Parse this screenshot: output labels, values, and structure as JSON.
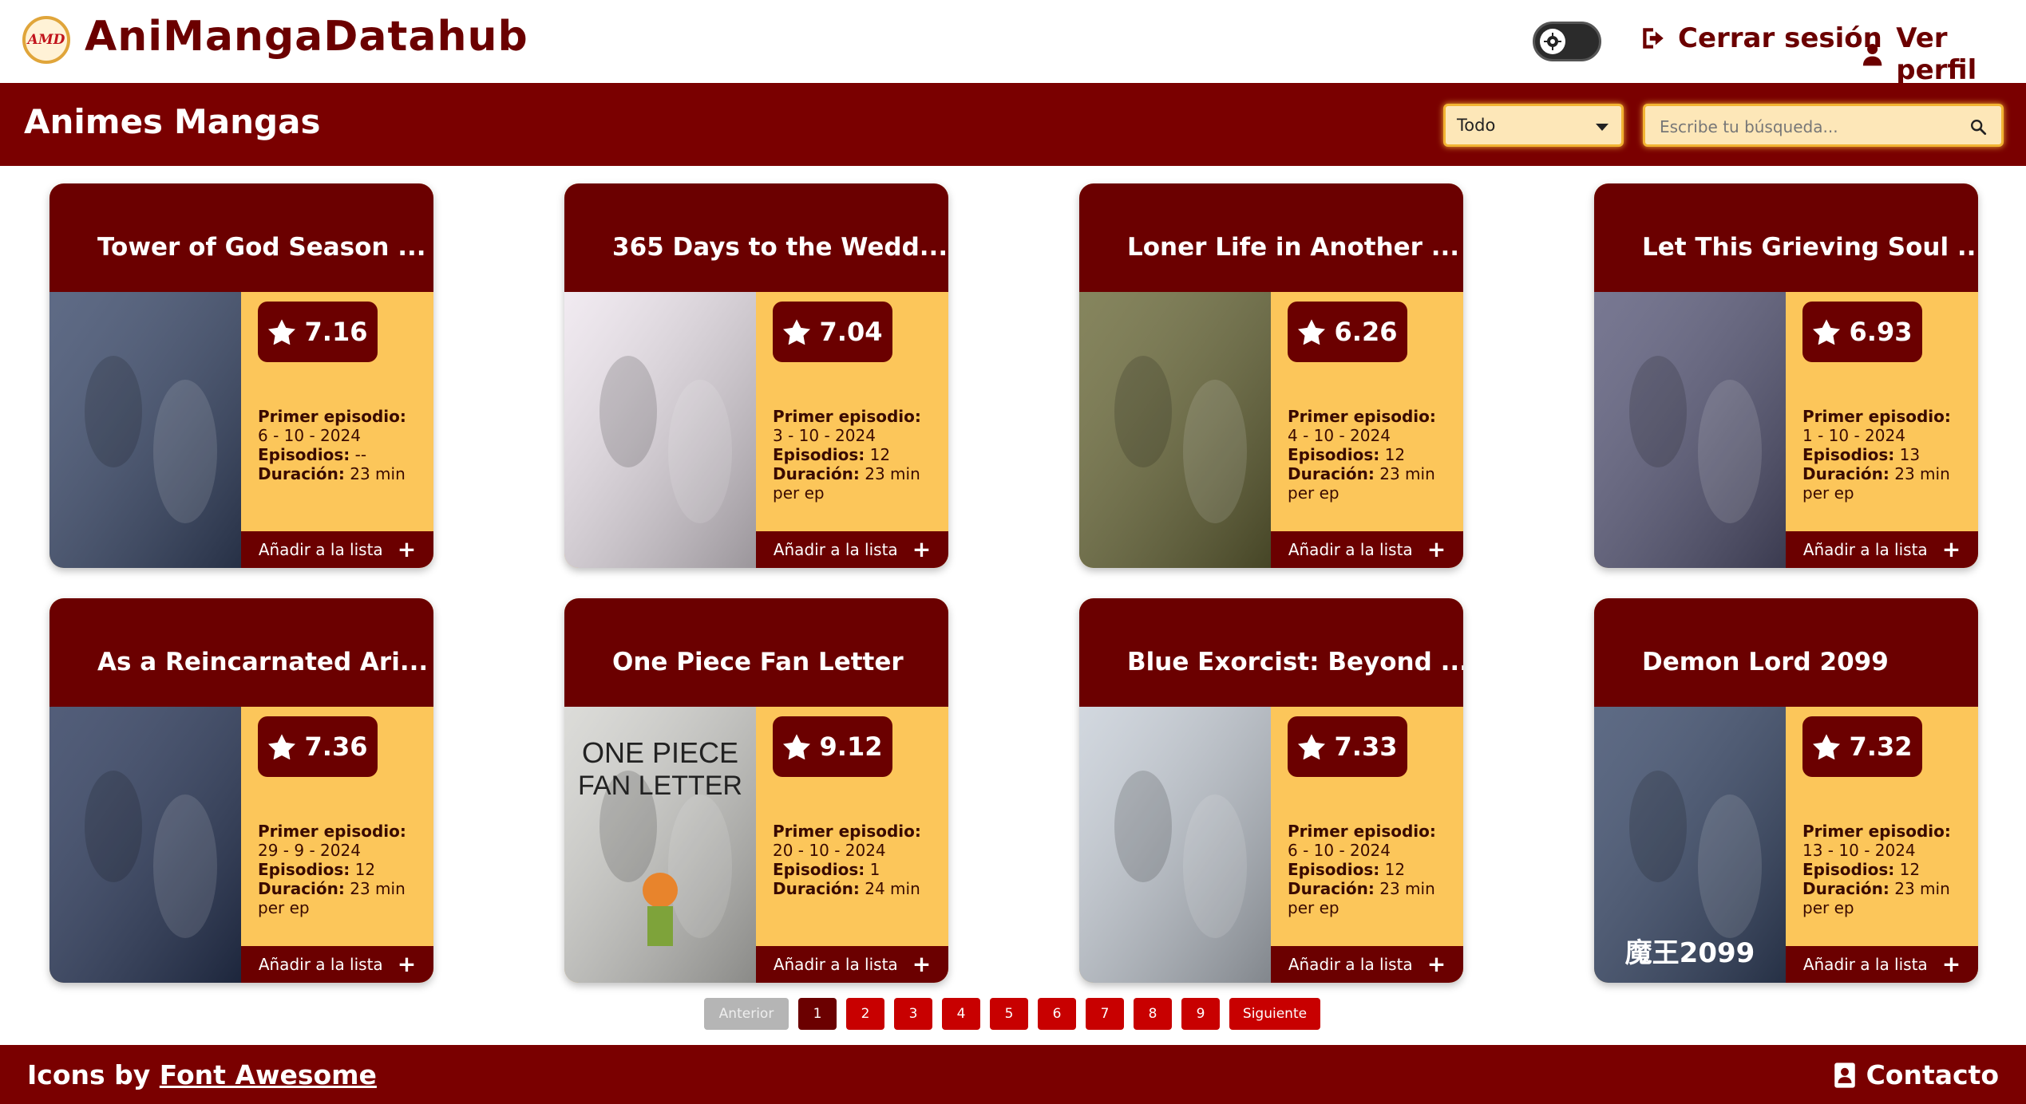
{
  "app": {
    "logo_text": "AMD",
    "brand": "AniMangaDatahub",
    "logout_label": "Cerrar sesión",
    "profile_label": "Ver perfil"
  },
  "nav": {
    "animes": "Animes",
    "mangas": "Mangas",
    "filter_selected": "Todo",
    "search_placeholder": "Escribe tu búsqueda..."
  },
  "labels": {
    "primer_episodio": "Primer episodio:",
    "episodios": "Episodios:",
    "duracion": "Duración:",
    "add": "Añadir a la lista"
  },
  "cards": [
    {
      "title": "Tower of God Season ...",
      "score": "7.16",
      "first_ep": "6 - 10 - 2024",
      "episodes": "--",
      "duration": "23 min",
      "poster_color": "#3b4a6b"
    },
    {
      "title": "365 Days to the Wedd...",
      "score": "7.04",
      "first_ep": "3 - 10 - 2024",
      "episodes": "12",
      "duration": "23 min per ep",
      "poster_color": "#eee6ee"
    },
    {
      "title": "Loner Life in Another ...",
      "score": "6.26",
      "first_ep": "4 - 10 - 2024",
      "episodes": "12",
      "duration": "23 min per ep",
      "poster_color": "#6b6a3a"
    },
    {
      "title": "Let This Grieving Soul ...",
      "score": "6.93",
      "first_ep": "1 - 10 - 2024",
      "episodes": "13",
      "duration": "23 min per ep",
      "poster_color": "#5a5a7a"
    },
    {
      "title": "As a Reincarnated Ari...",
      "score": "7.36",
      "first_ep": "29 - 9 - 2024",
      "episodes": "12",
      "duration": "23 min per ep",
      "poster_color": "#2c3a5c"
    },
    {
      "title": "One Piece Fan Letter",
      "score": "9.12",
      "first_ep": "20 - 10 - 2024",
      "episodes": "1",
      "duration": "24 min",
      "poster_color": "#d4d4d0",
      "poster_text": [
        "ONE PIECE",
        "FAN LETTER"
      ]
    },
    {
      "title": "Blue Exorcist: Beyond ...",
      "score": "7.33",
      "first_ep": "6 - 10 - 2024",
      "episodes": "12",
      "duration": "23 min per ep",
      "poster_color": "#c8cfd8"
    },
    {
      "title": "Demon Lord 2099",
      "score": "7.32",
      "first_ep": "13 - 10 - 2024",
      "episodes": "12",
      "duration": "23 min per ep",
      "poster_color": "#3a4a6a",
      "poster_text": [
        "魔王2099"
      ]
    }
  ],
  "pagination": {
    "prev": "Anterior",
    "pages": [
      "1",
      "2",
      "3",
      "4",
      "5",
      "6",
      "7",
      "8",
      "9"
    ],
    "active": "1",
    "next": "Siguiente"
  },
  "footer": {
    "icons_by": "Icons by",
    "icons_link": "Font Awesome",
    "contact": "Contacto"
  },
  "colors": {
    "primary": "#7a0000",
    "card_head": "#6b0000",
    "card_body": "#fcc65a",
    "accent_border": "#f2b433",
    "page_button": "#c80000"
  }
}
